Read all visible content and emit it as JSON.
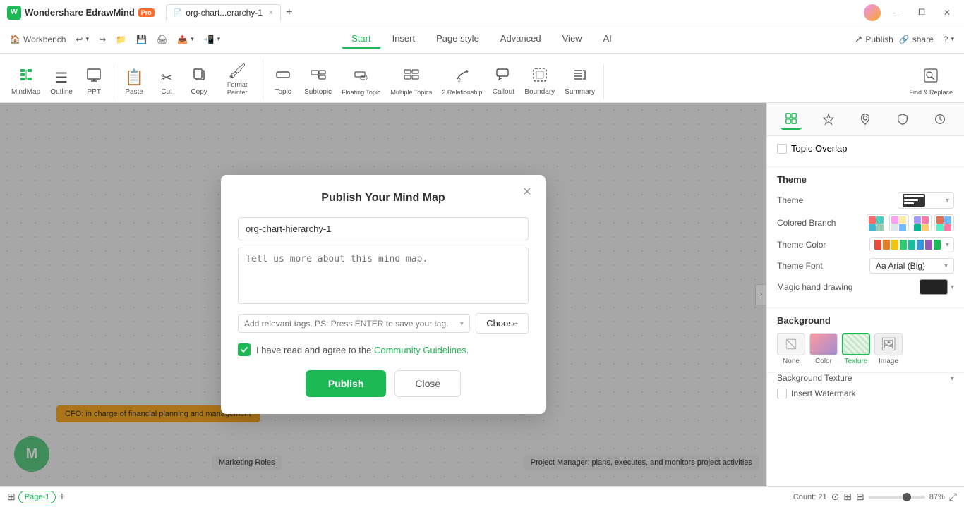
{
  "app": {
    "name": "Wondershare EdrawMind",
    "badge": "Pro",
    "tab_name": "org-chart...erarchy-1",
    "window_controls": [
      "minimize",
      "maximize",
      "close"
    ]
  },
  "toolbar": {
    "back_label": "←",
    "forward_label": "→",
    "nav_tabs": [
      "Start",
      "Insert",
      "Page style",
      "Advanced",
      "View",
      "AI"
    ],
    "active_tab": "Start",
    "publish_label": "Publish",
    "share_label": "share",
    "help_label": "?"
  },
  "quick_tools": [
    {
      "id": "workbench",
      "label": "Workbench",
      "icon": "🏠"
    },
    {
      "id": "undo",
      "label": "↩",
      "icon": "↩"
    },
    {
      "id": "redo",
      "label": "↪",
      "icon": "↪"
    }
  ],
  "ribbon": {
    "groups": [
      {
        "id": "view-group",
        "items": [
          {
            "id": "mindmap",
            "label": "MindMap",
            "icon": "⊞",
            "active": true
          },
          {
            "id": "outline",
            "label": "Outline",
            "icon": "☰"
          },
          {
            "id": "ppt",
            "label": "PPT",
            "icon": "▭"
          }
        ]
      },
      {
        "id": "edit-group",
        "items": [
          {
            "id": "paste",
            "label": "Paste",
            "icon": "📋",
            "has_arrow": true
          },
          {
            "id": "cut",
            "label": "Cut",
            "icon": "✂"
          },
          {
            "id": "copy",
            "label": "Copy",
            "icon": "⬡"
          },
          {
            "id": "format-painter",
            "label": "Format Painter",
            "icon": "🖌"
          }
        ]
      },
      {
        "id": "insert-group",
        "items": [
          {
            "id": "topic",
            "label": "Topic",
            "icon": "⬜",
            "has_arrow": true
          },
          {
            "id": "subtopic",
            "label": "Subtopic",
            "icon": "⬛"
          },
          {
            "id": "floating-topic",
            "label": "Floating Topic",
            "icon": "⊡"
          },
          {
            "id": "multiple-topics",
            "label": "Multiple Topics",
            "icon": "⊞",
            "has_arrow": true
          },
          {
            "id": "relationship",
            "label": "Relationship",
            "icon": "↗",
            "has_arrow": true
          },
          {
            "id": "callout",
            "label": "Callout",
            "icon": "💬"
          },
          {
            "id": "boundary",
            "label": "Boundary",
            "icon": "◻"
          },
          {
            "id": "summary",
            "label": "Summary",
            "icon": "≡"
          }
        ]
      },
      {
        "id": "find-group",
        "items": [
          {
            "id": "find-replace",
            "label": "Find & Replace",
            "icon": "🔍"
          }
        ]
      }
    ]
  },
  "modal": {
    "title": "Publish Your Mind Map",
    "name_value": "org-chart-hierarchy-1",
    "description_placeholder": "Tell us more about this mind map.",
    "tags_placeholder": "Add relevant tags. PS: Press ENTER to save your tag.",
    "choose_label": "Choose",
    "agree_text": "I have read and agree to the ",
    "agree_link": "Community Guidelines",
    "agree_period": ".",
    "publish_label": "Publish",
    "close_label": "Close"
  },
  "right_panel": {
    "icons": [
      "layout",
      "star",
      "location",
      "shield",
      "clock"
    ],
    "topic_overlap_label": "Topic Overlap",
    "theme_section": {
      "title": "Theme",
      "theme_label": "Theme",
      "colored_branch_label": "Colored Branch",
      "theme_color_label": "Theme Color",
      "theme_font_label": "Theme Font",
      "theme_font_value": "Aa Arial (Big)",
      "magic_hand_label": "Magic hand drawing",
      "color_options": [
        {
          "colors": [
            "#ff6b6b",
            "#4ecdc4",
            "#45b7d1",
            "#96ceb4"
          ]
        },
        {
          "colors": [
            "#ff9ff3",
            "#ffeaa7",
            "#dfe6e9",
            "#74b9ff"
          ]
        },
        {
          "colors": [
            "#a29bfe",
            "#fd79a8",
            "#00b894",
            "#fdcb6e"
          ]
        },
        {
          "colors": [
            "#e17055",
            "#74b9ff",
            "#55efc4",
            "#fd79a8"
          ]
        }
      ],
      "theme_colors": [
        "#e74c3c",
        "#e67e22",
        "#f1c40f",
        "#2ecc71",
        "#1abc9c",
        "#3498db",
        "#9b59b6",
        "#1db954",
        "#333",
        "#666"
      ]
    },
    "background_section": {
      "title": "Background",
      "options": [
        "None",
        "Color",
        "Texture",
        "Image"
      ],
      "active": "Texture",
      "texture_label": "Background Texture",
      "watermark_label": "Insert Watermark"
    }
  },
  "canvas": {
    "nodes": [
      {
        "id": "cfo",
        "text": "CFO: in charge of financial planning and management"
      },
      {
        "id": "marketing",
        "text": "Marketing Roles"
      },
      {
        "id": "project",
        "text": "Project Manager: plans, executes, and monitors project activities"
      }
    ]
  },
  "status_bar": {
    "page_label": "Page-1",
    "count_label": "Count: 21",
    "zoom_percent": "87%",
    "page_tab": "Page-1"
  }
}
